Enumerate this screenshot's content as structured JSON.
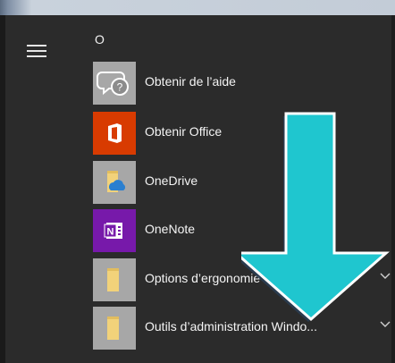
{
  "menu": {
    "section_letter": "O",
    "items": [
      {
        "label": "Obtenir de l’aide",
        "icon": "help-chat-icon",
        "tile_color": "#a7a7a7",
        "expandable": false
      },
      {
        "label": "Obtenir Office",
        "icon": "office-icon",
        "tile_color": "#d83b01",
        "expandable": false
      },
      {
        "label": "OneDrive",
        "icon": "onedrive-folder-icon",
        "tile_color": "#a7a7a7",
        "expandable": false
      },
      {
        "label": "OneNote",
        "icon": "onenote-icon",
        "tile_color": "#7719aa",
        "expandable": false
      },
      {
        "label": "Options d’ergonomie",
        "icon": "folder-icon",
        "tile_color": "#a7a7a7",
        "expandable": true
      },
      {
        "label": "Outils d’administration Windo...",
        "icon": "folder-icon",
        "tile_color": "#a7a7a7",
        "expandable": true
      }
    ]
  },
  "overlay": {
    "arrow_color": "#1fc6cf",
    "arrow_direction": "down"
  }
}
